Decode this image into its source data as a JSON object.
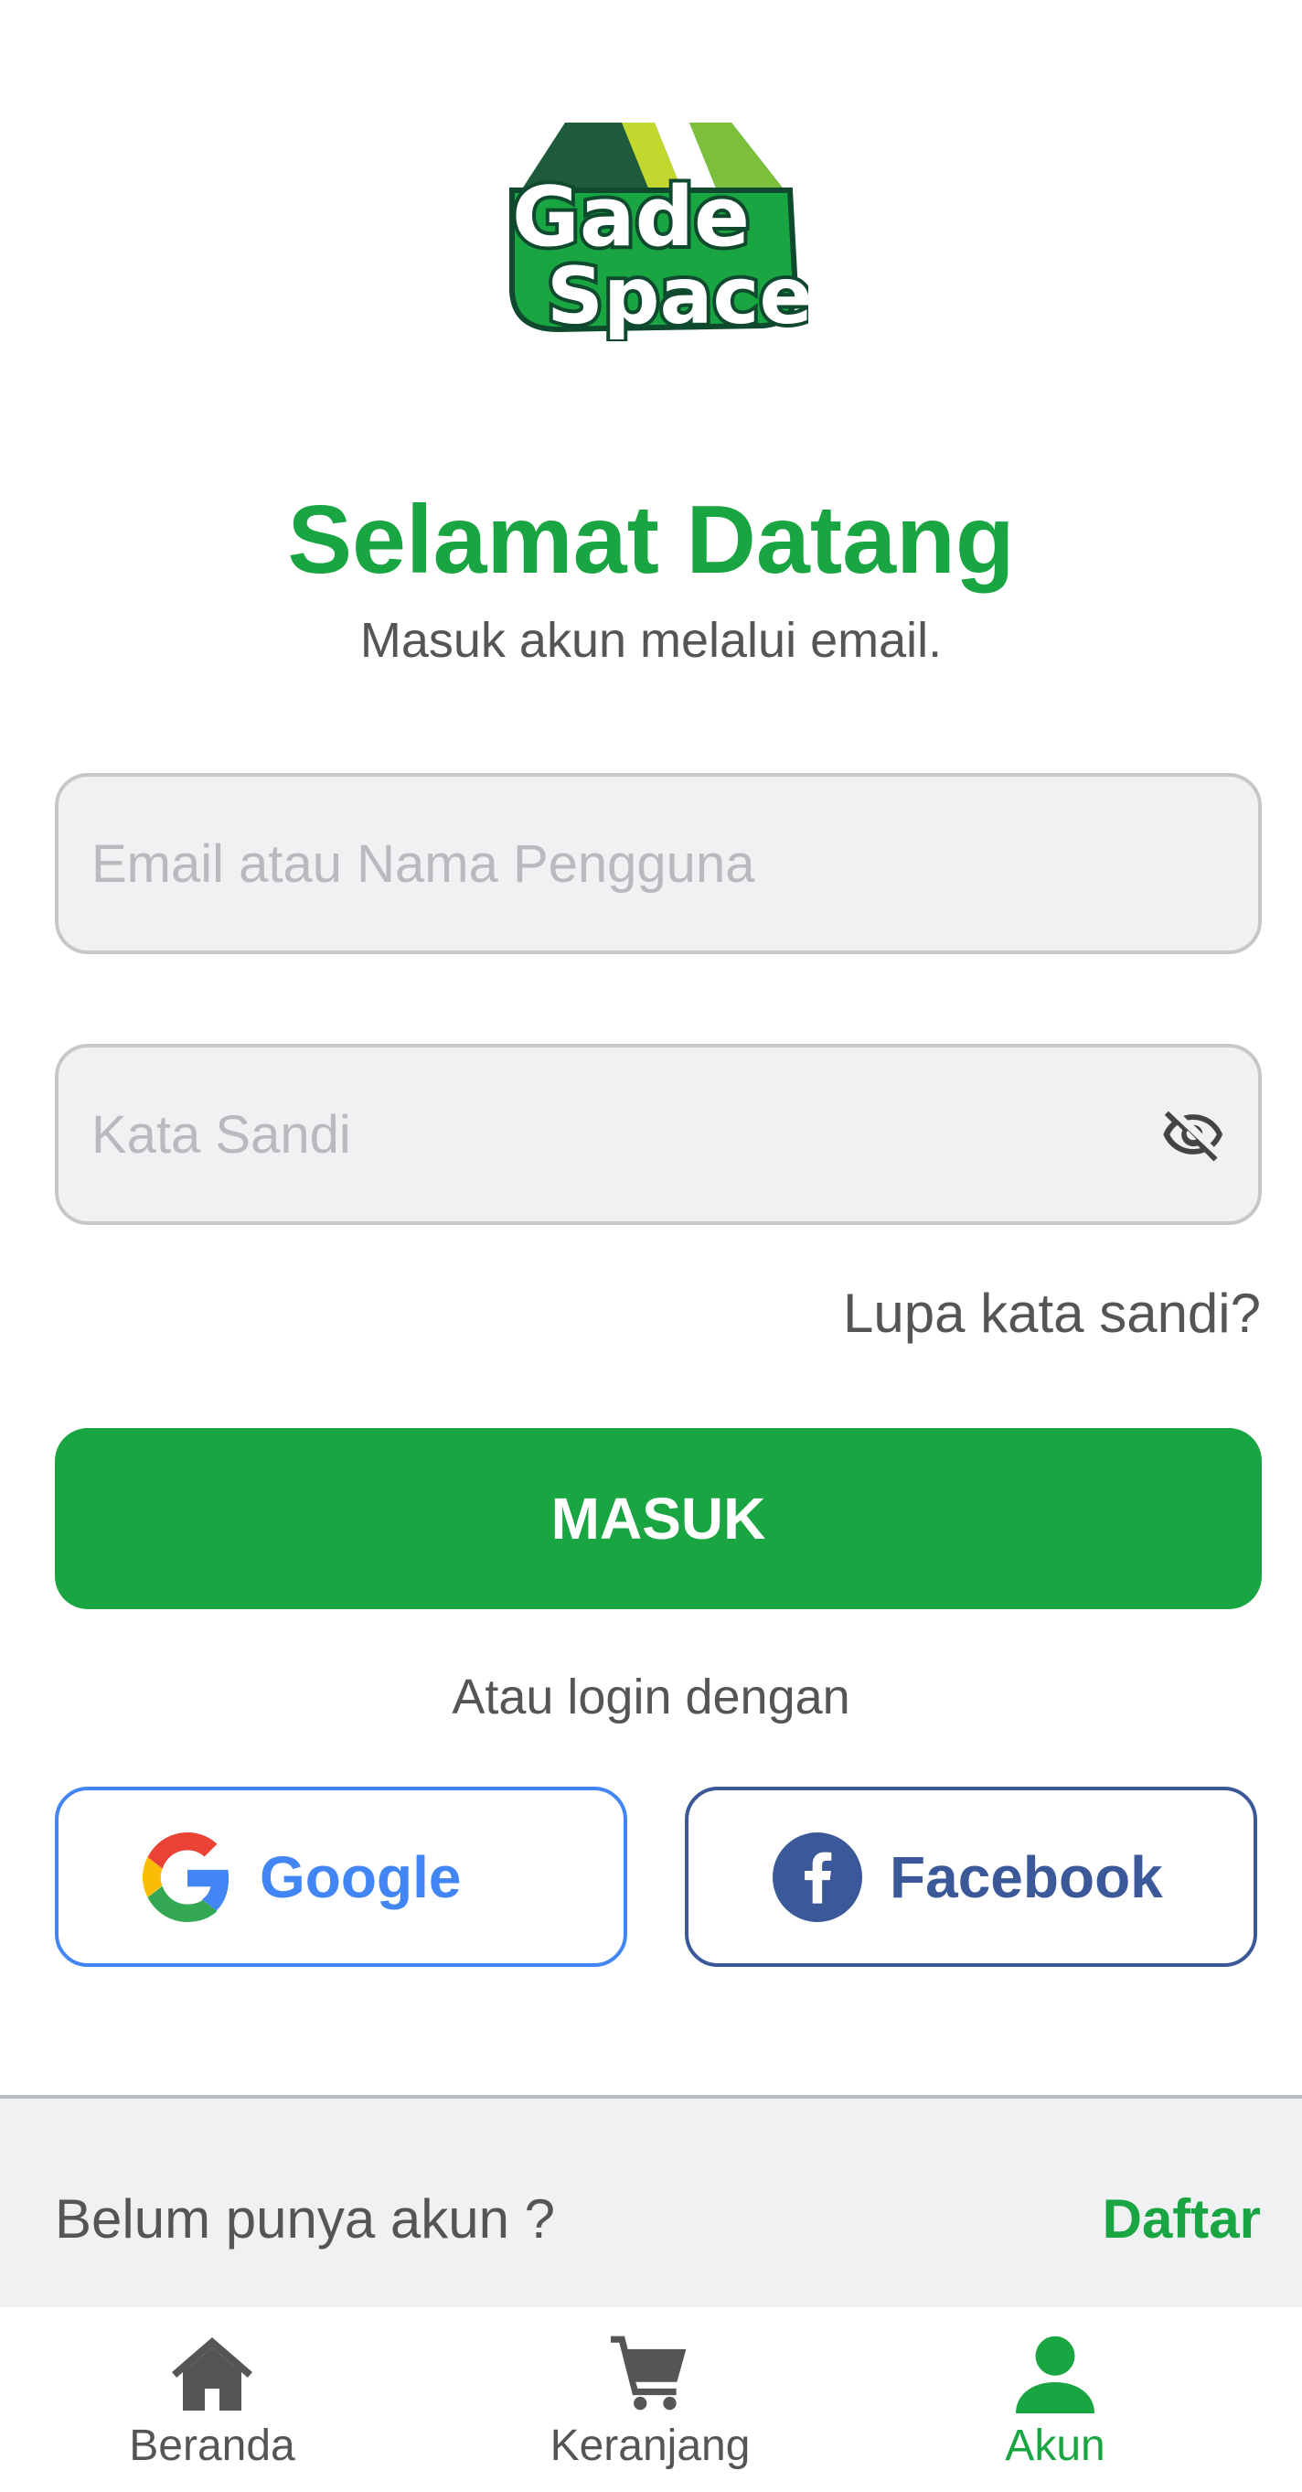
{
  "logo": {
    "line1": "Gade",
    "line2": "Space"
  },
  "header": {
    "title": "Selamat Datang",
    "subtitle": "Masuk akun melalui email."
  },
  "form": {
    "email_placeholder": "Email atau Nama Pengguna",
    "email_value": "",
    "password_placeholder": "Kata Sandi",
    "password_value": "",
    "password_toggle_icon": "eye-off-icon",
    "forgot_label": "Lupa kata sandi?",
    "submit_label": "MASUK"
  },
  "social": {
    "divider_text": "Atau login dengan",
    "google_label": "Google",
    "facebook_label": "Facebook"
  },
  "signup": {
    "prompt": "Belum punya akun ?",
    "link_label": "Daftar"
  },
  "bottom_nav": {
    "items": [
      {
        "label": "Beranda",
        "icon": "home-icon",
        "active": false
      },
      {
        "label": "Keranjang",
        "icon": "cart-icon",
        "active": false
      },
      {
        "label": "Akun",
        "icon": "user-icon",
        "active": true
      }
    ]
  },
  "colors": {
    "brand_green": "#19a541",
    "google_blue": "#4286f5",
    "facebook_blue": "#3b5998",
    "field_bg": "#f0f1f3"
  }
}
